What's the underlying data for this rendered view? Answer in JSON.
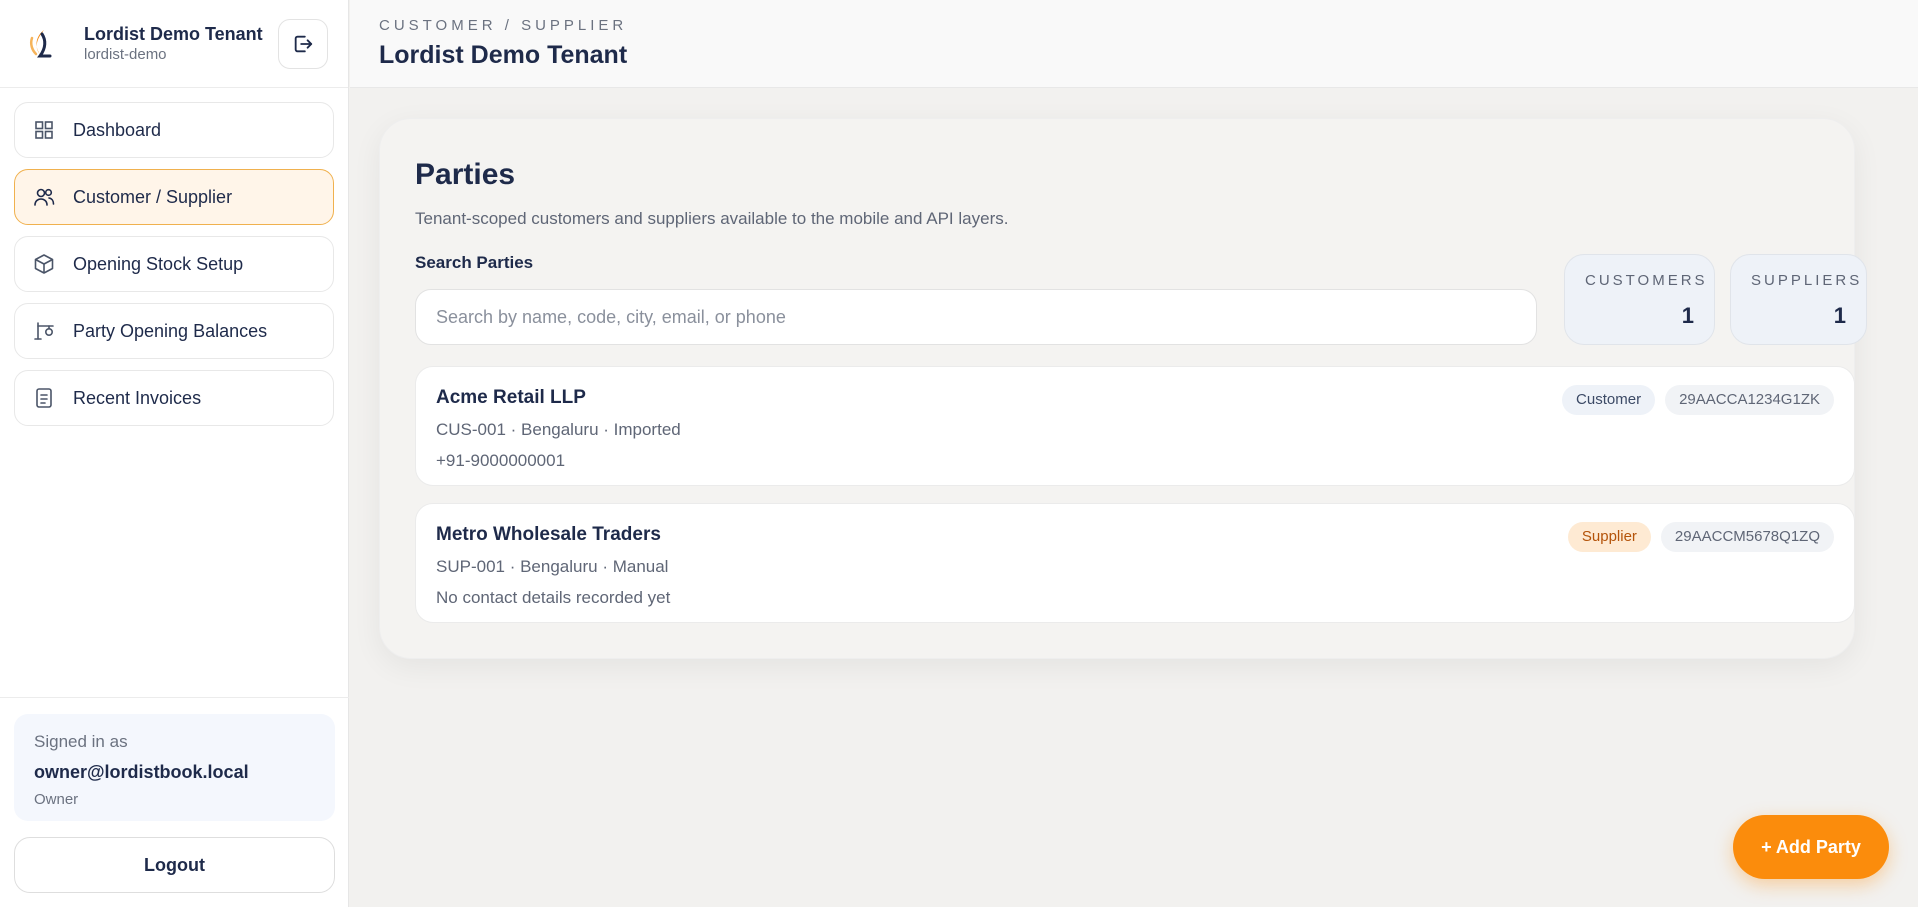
{
  "brand": {
    "title": "Lordist Demo Tenant",
    "subtitle": "lordist-demo"
  },
  "nav": [
    {
      "label": "Dashboard",
      "icon": "grid-icon"
    },
    {
      "label": "Customer / Supplier",
      "icon": "users-icon",
      "active": true
    },
    {
      "label": "Opening Stock Setup",
      "icon": "box-icon"
    },
    {
      "label": "Party Opening Balances",
      "icon": "balance-icon"
    },
    {
      "label": "Recent Invoices",
      "icon": "receipt-icon"
    }
  ],
  "footer": {
    "signed_label": "Signed in as",
    "email": "owner@lordistbook.local",
    "role": "Owner",
    "logout_label": "Logout"
  },
  "header": {
    "breadcrumb": "CUSTOMER / SUPPLIER",
    "title": "Lordist Demo Tenant"
  },
  "main": {
    "title": "Parties",
    "description": "Tenant-scoped customers and suppliers available to the mobile and API layers.",
    "search_label": "Search Parties",
    "search_placeholder": "Search by name, code, city, email, or phone",
    "search_value": "",
    "stats": [
      {
        "label": "CUSTOMERS",
        "value": "1"
      },
      {
        "label": "SUPPLIERS",
        "value": "1"
      }
    ],
    "parties": [
      {
        "name": "Acme Retail LLP",
        "meta": "CUS-001 · Bengaluru · Imported",
        "contact": "+91-9000000001",
        "type": "Customer",
        "gstin": "29AACCA1234G1ZK"
      },
      {
        "name": "Metro Wholesale Traders",
        "meta": "SUP-001 · Bengaluru · Manual",
        "contact": "No contact details recorded yet",
        "type": "Supplier",
        "gstin": "29AACCM5678Q1ZQ"
      }
    ]
  },
  "fab": {
    "label": "+ Add Party"
  },
  "colors": {
    "accent": "#fb8c0c",
    "active_bg": "#fff5e9",
    "active_border": "#f0b14e",
    "navy": "#1e2a4a"
  }
}
